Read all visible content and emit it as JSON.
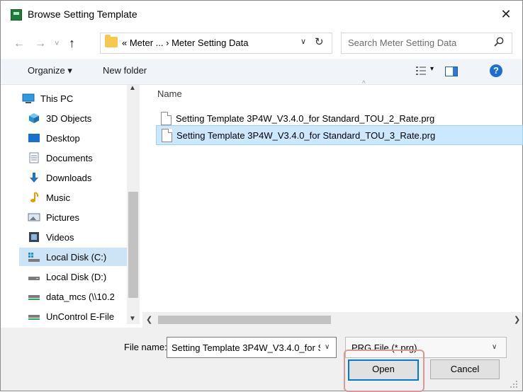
{
  "window": {
    "title": "Browse Setting Template",
    "close_glyph": "✕"
  },
  "nav": {
    "back": "←",
    "forward": "→",
    "recent": "˅",
    "up": "↑",
    "address": "« Meter ...  ›  Meter Setting Data",
    "address_chevron": "∨",
    "refresh": "↻",
    "search_placeholder": "Search Meter Setting Data"
  },
  "toolbar": {
    "organize": "Organize ▾",
    "new_folder": "New folder",
    "view_chevron": "▾",
    "help": "?"
  },
  "sidebar": {
    "items": [
      {
        "label": "This PC",
        "icon": "computer-icon"
      },
      {
        "label": "3D Objects",
        "icon": "cube-icon"
      },
      {
        "label": "Desktop",
        "icon": "desktop-icon"
      },
      {
        "label": "Documents",
        "icon": "document-icon"
      },
      {
        "label": "Downloads",
        "icon": "download-icon"
      },
      {
        "label": "Music",
        "icon": "music-icon"
      },
      {
        "label": "Pictures",
        "icon": "picture-icon"
      },
      {
        "label": "Videos",
        "icon": "video-icon"
      },
      {
        "label": "Local Disk (C:)",
        "icon": "drive-windows-icon",
        "selected": true
      },
      {
        "label": "Local Disk (D:)",
        "icon": "drive-icon"
      },
      {
        "label": "data_mcs (\\\\10.2",
        "icon": "network-drive-icon"
      },
      {
        "label": "UnControl E-File",
        "icon": "network-drive-icon"
      }
    ]
  },
  "filelist": {
    "column_name": "Name",
    "files": [
      {
        "name": "Setting Template 3P4W_V3.4.0_for Standard_TOU_2_Rate.prg",
        "selected": false
      },
      {
        "name": "Setting Template 3P4W_V3.4.0_for Standard_TOU_3_Rate.prg",
        "selected": true
      }
    ]
  },
  "footer": {
    "file_name_label": "File name:",
    "file_name_value": "Setting Template 3P4W_V3.4.0_for S",
    "file_type": "PRG File (*.prg)",
    "open_label": "Open",
    "cancel_label": "Cancel"
  },
  "colors": {
    "selection": "#cce8ff",
    "accent": "#0078d7",
    "highlight_box": "#d99a97"
  }
}
